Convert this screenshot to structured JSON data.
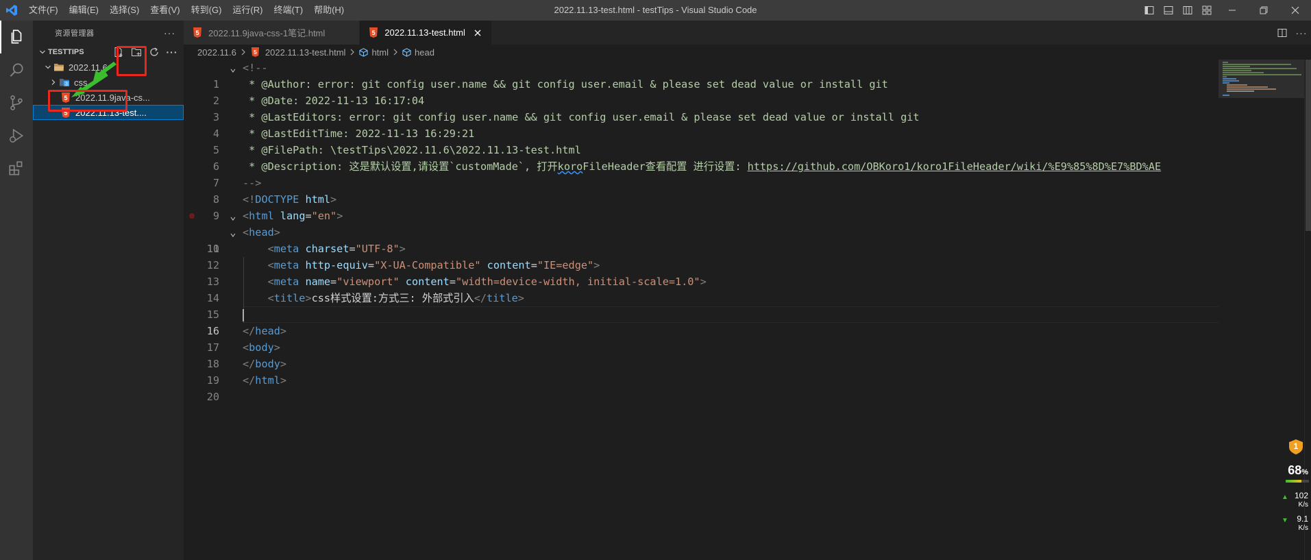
{
  "window": {
    "title": "2022.11.13-test.html - testTips - Visual Studio Code",
    "menu": [
      "文件(F)",
      "编辑(E)",
      "选择(S)",
      "查看(V)",
      "转到(G)",
      "运行(R)",
      "终端(T)",
      "帮助(H)"
    ]
  },
  "activity_bar": {
    "items": [
      "explorer-icon",
      "search-icon",
      "source-control-icon",
      "run-debug-icon",
      "extensions-icon"
    ],
    "active": "explorer-icon"
  },
  "sidebar": {
    "header": "资源管理器",
    "section": "TESTTIPS",
    "tree": [
      {
        "label": "2022.11.6",
        "kind": "folder",
        "expanded": true
      },
      {
        "label": "css",
        "kind": "folder",
        "expanded": false
      },
      {
        "label": "2022.11.9java-cs...",
        "kind": "html-file"
      },
      {
        "label": "2022.11.13-test....",
        "kind": "html-file",
        "selected": true
      }
    ]
  },
  "tabs": [
    {
      "label": "2022.11.9java-css-1笔记.html",
      "active": false
    },
    {
      "label": "2022.11.13-test.html",
      "active": true
    }
  ],
  "breadcrumb": {
    "folder": "2022.11.6",
    "file": "2022.11.13-test.html",
    "el1": "html",
    "el2": "head"
  },
  "editor": {
    "lines": [
      {
        "n": "1",
        "fold": "v"
      },
      {
        "n": "2"
      },
      {
        "n": "3"
      },
      {
        "n": "4"
      },
      {
        "n": "5"
      },
      {
        "n": "6"
      },
      {
        "n": "7"
      },
      {
        "n": "8"
      },
      {
        "n": "9"
      },
      {
        "n": "10",
        "fold": "v",
        "breakpoint": true
      },
      {
        "n": "11",
        "fold": "v"
      },
      {
        "n": "12"
      },
      {
        "n": "13"
      },
      {
        "n": "14"
      },
      {
        "n": "15"
      },
      {
        "n": "16",
        "current": true
      },
      {
        "n": "17"
      },
      {
        "n": "18"
      },
      {
        "n": "19"
      },
      {
        "n": "20"
      }
    ],
    "text": {
      "l1": "<!--",
      "l2": " * @Author: error: git config user.name && git config user.email & please set dead value or install git",
      "l3": " * @Date: 2022-11-13 16:17:04",
      "l4": " * @LastEditors: error: git config user.name && git config user.email & please set dead value or install git",
      "l5": " * @LastEditTime: 2022-11-13 16:29:21",
      "l6": " * @FilePath: \\testTips\\2022.11.6\\2022.11.13-test.html",
      "l7a": " * @Description: 这是默认设置,请设置`customMade`, 打开",
      "l7b": "koro",
      "l7c": "FileHeader查看配置 进行设置: ",
      "l7d": "https://github.com/OBKoro1/koro1FileHeader/wiki/%E9%85%8D%E7%BD%AE",
      "l8": "-->",
      "l9a": "<!",
      "l9b": "DOCTYPE",
      "l9c": " html",
      "l9d": ">",
      "l10_tag": "html",
      "l10_attr": "lang",
      "l10_val": "\"en\"",
      "l11_tag": "head",
      "l12_tag": "meta",
      "l12_attr": "charset",
      "l12_val": "\"UTF-8\"",
      "l13_tag": "meta",
      "l13_attr1": "http-equiv",
      "l13_val1": "\"X-UA-Compatible\"",
      "l13_attr2": "content",
      "l13_val2": "\"IE=edge\"",
      "l14_tag": "meta",
      "l14_attr1": "name",
      "l14_val1": "\"viewport\"",
      "l14_attr2": "content",
      "l14_val2": "\"width=device-width, initial-scale=1.0\"",
      "l15_tag": "title",
      "l15_text": "css样式设置:方式三: 外部式引入",
      "l17_tag": "head",
      "l18_tag": "body",
      "l19_tag": "body",
      "l20_tag": "html"
    }
  },
  "overlay": {
    "badge": "1",
    "percent": "68",
    "percent_unit": "%",
    "up_speed": "102",
    "up_unit": "K/s",
    "down_speed": "9.1",
    "down_unit": "K/s"
  },
  "colors": {
    "annotation_red": "#e8281f",
    "annotation_arrow": "#3bbf2e",
    "html_icon": "#e44d26",
    "css_icon": "#42a5f5"
  }
}
